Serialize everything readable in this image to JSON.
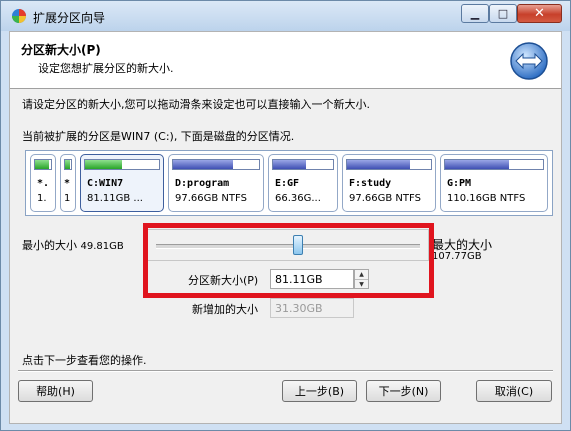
{
  "window": {
    "title": "扩展分区向导"
  },
  "header": {
    "title": "分区新大小(P)",
    "subtitle": "设定您想扩展分区的新大小."
  },
  "instructions": "请设定分区的新大小,您可以拖动滑条来设定也可以直接输入一个新大小.",
  "partition_caption": "当前被扩展的分区是WIN7 (C:), 下面是磁盘的分区情况.",
  "partitions": [
    {
      "name": "*.",
      "size": "1.",
      "used_fraction": 0.9,
      "color": "green"
    },
    {
      "name": "*",
      "size": "1",
      "used_fraction": 0.9,
      "color": "green"
    },
    {
      "name": "C:WIN7",
      "size": "81.11GB ...",
      "used_fraction": 0.5,
      "color": "green"
    },
    {
      "name": "D:program",
      "size": "97.66GB NTFS",
      "used_fraction": 0.7,
      "color": "blue"
    },
    {
      "name": "E:GF",
      "size": "66.36G...",
      "used_fraction": 0.55,
      "color": "blue"
    },
    {
      "name": "F:study",
      "size": "97.66GB NTFS",
      "used_fraction": 0.75,
      "color": "blue"
    },
    {
      "name": "G:PM",
      "size": "110.16GB NTFS",
      "used_fraction": 0.65,
      "color": "blue"
    }
  ],
  "slider": {
    "min_label": "最小的大小",
    "min_value": "49.81GB",
    "max_label": "最大的大小",
    "max_value": "107.77GB",
    "value_fraction": 0.54
  },
  "new_size": {
    "label": "分区新大小(P)",
    "value": "81.11GB"
  },
  "added_size": {
    "label": "新增加的大小",
    "value": "31.30GB"
  },
  "footer_hint": "点击下一步查看您的操作.",
  "buttons": {
    "help": "帮助(H)",
    "back": "上一步(B)",
    "next": "下一步(N)",
    "cancel": "取消(C)"
  },
  "colors": {
    "highlight_box": "#e0141e",
    "accent_blue": "#3f4fb3",
    "accent_green": "#28a428"
  }
}
